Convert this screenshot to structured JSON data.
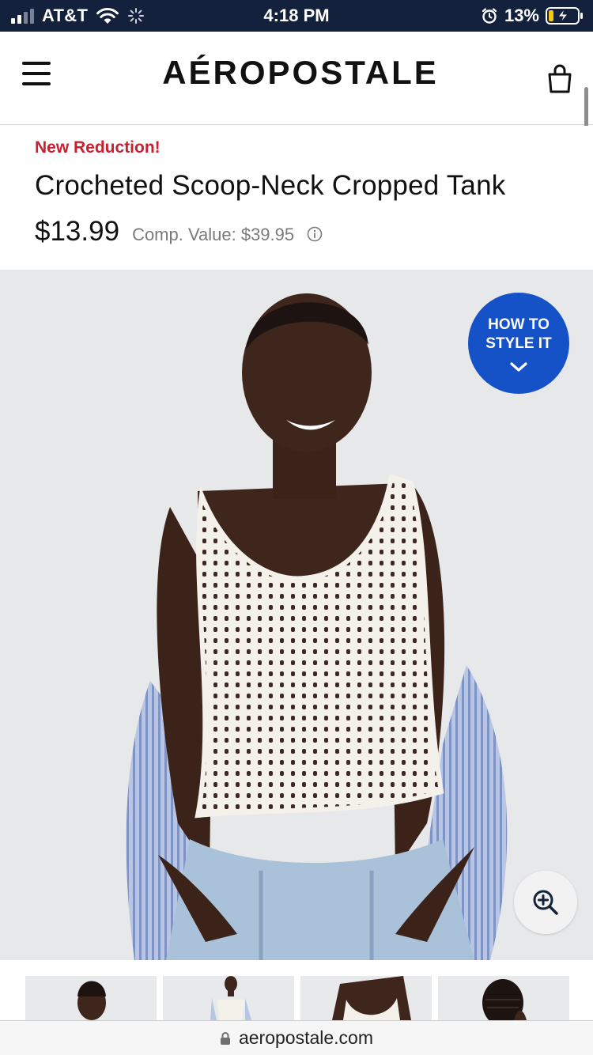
{
  "status_bar": {
    "carrier": "AT&T",
    "time": "4:18 PM",
    "battery_percent": "13%",
    "icons": [
      "signal-icon",
      "wifi-icon",
      "loading-icon",
      "alarm-icon",
      "battery-charging-icon"
    ]
  },
  "header": {
    "logo": "AÉROPOSTALE",
    "icons": [
      "hamburger-menu-icon",
      "shopping-bag-icon"
    ]
  },
  "product": {
    "promo": "New Reduction!",
    "title": "Crocheted Scoop-Neck Cropped Tank",
    "price": "$13.99",
    "comp_value": "Comp. Value: $39.95",
    "icons": [
      "info-icon"
    ]
  },
  "hero": {
    "style_button": {
      "line1": "HOW TO",
      "line2": "STYLE IT",
      "icon": "chevron-down-icon"
    },
    "zoom_icon": "zoom-in-icon"
  },
  "colors": {
    "status_bar_bg": "#14213d",
    "promo_red": "#c8202f",
    "style_button_blue": "#1552c7",
    "hero_bg": "#e7e8ea"
  },
  "browser": {
    "url": "aeropostale.com",
    "icon": "lock-icon"
  }
}
